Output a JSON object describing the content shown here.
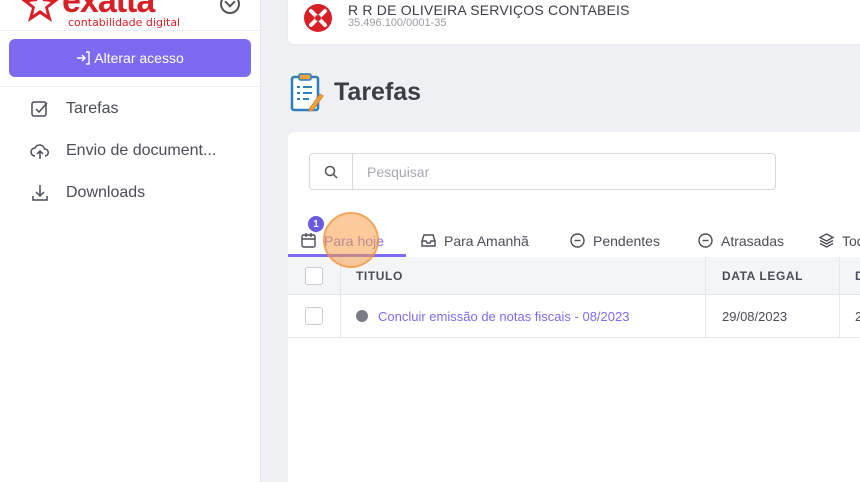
{
  "sidebar": {
    "logo_text": "exatta",
    "logo_subtitle": "contabilidade digital",
    "access_button": {
      "icon": "login-arrow-icon",
      "label": "Alterar acesso"
    },
    "nav": [
      {
        "icon": "checkbox-icon",
        "label": "Tarefas"
      },
      {
        "icon": "cloud-upload-icon",
        "label": "Envio de document..."
      },
      {
        "icon": "download-icon",
        "label": "Downloads"
      }
    ]
  },
  "company": {
    "name": "R R DE OLIVEIRA SERVIÇOS CONTABEIS",
    "cnpj": "35.496.100/0001-35"
  },
  "page": {
    "title": "Tarefas"
  },
  "search": {
    "placeholder": "Pesquisar",
    "value": ""
  },
  "tabs": [
    {
      "label": "Para hoje",
      "icon": "calendar-icon",
      "badge": "1",
      "active": true
    },
    {
      "label": "Para Amanhã",
      "icon": "inbox-icon"
    },
    {
      "label": "Pendentes",
      "icon": "minus-circle-icon"
    },
    {
      "label": "Atrasadas",
      "icon": "minus-circle-icon"
    },
    {
      "label": "Tod",
      "icon": "layers-icon"
    }
  ],
  "table": {
    "headers": {
      "title": "TITULO",
      "legal_date": "DATA LEGAL",
      "next": "D"
    },
    "rows": [
      {
        "title": "Concluir emissão de notas fiscais - 08/2023",
        "legal_date": "29/08/2023",
        "next": "2"
      }
    ]
  },
  "colors": {
    "accent": "#7c6bf0",
    "brand_red": "#d91f26",
    "status_gray": "#7a7c83"
  }
}
